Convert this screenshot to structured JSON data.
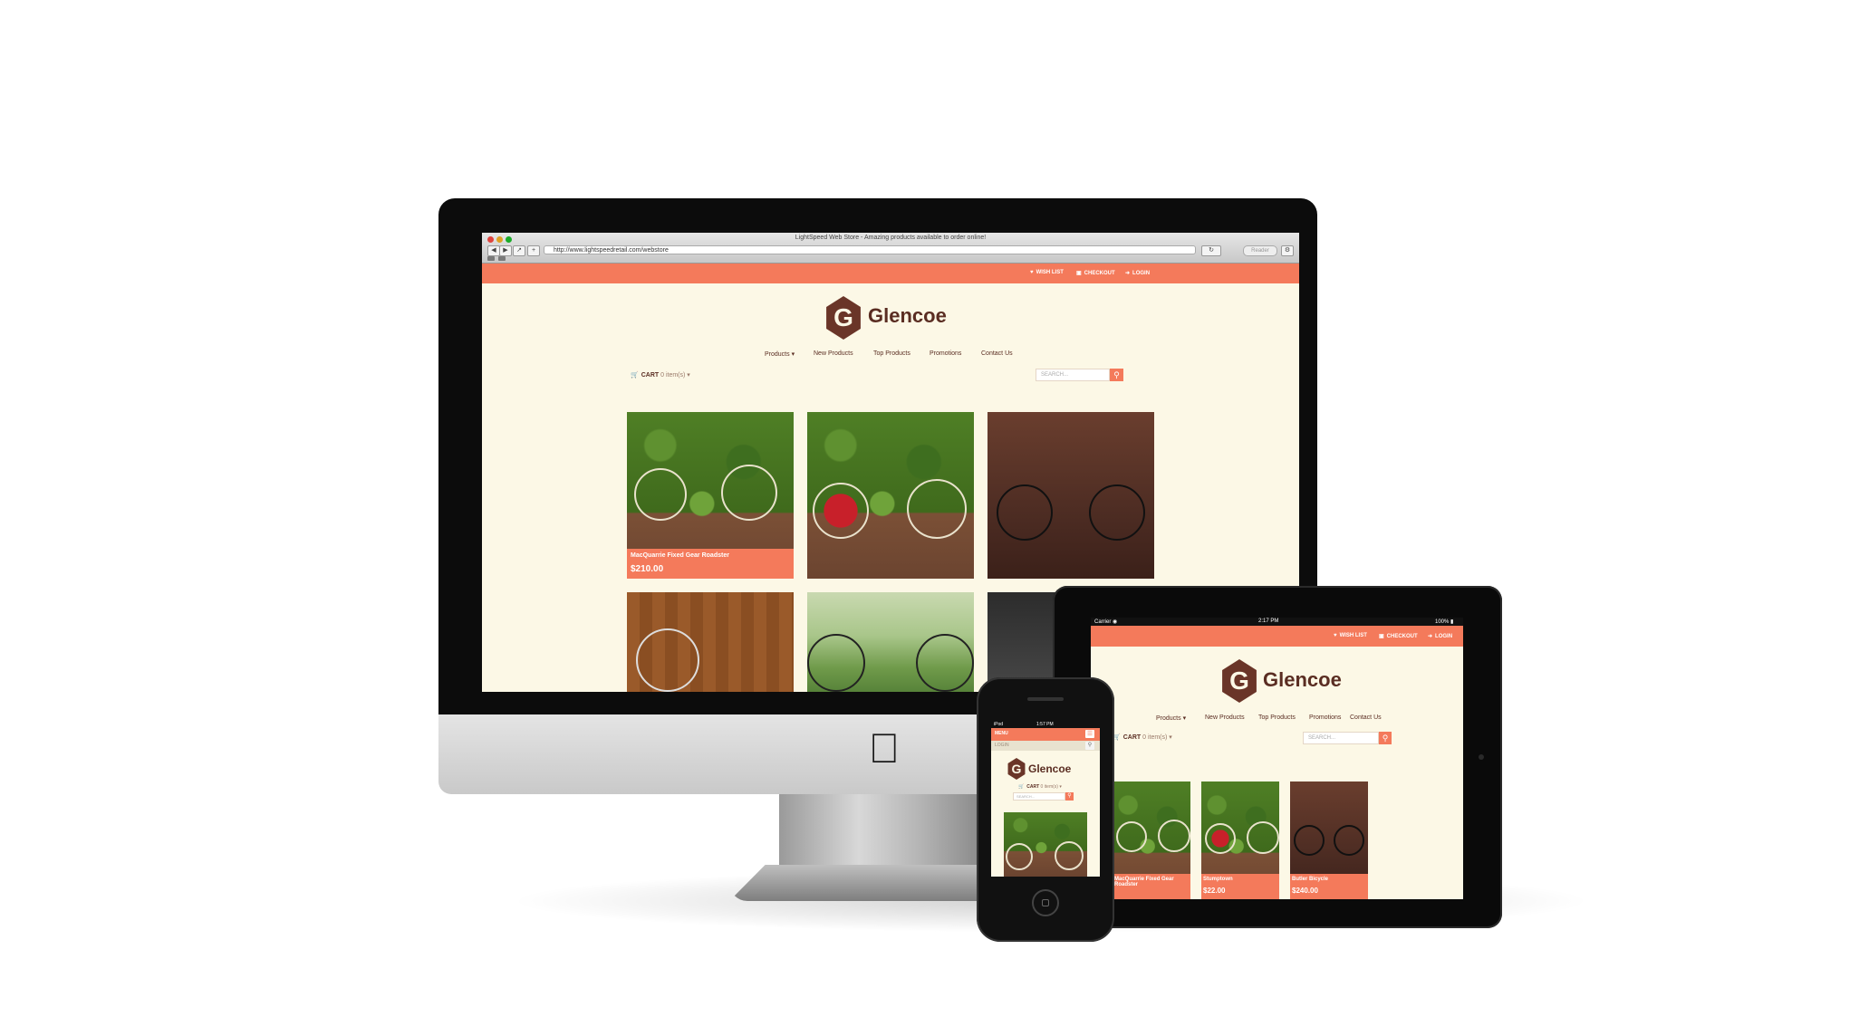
{
  "desktop": {
    "window_title": "LightSpeed Web Store - Amazing products available to order online!",
    "url": "http://www.lightspeedretail.com/webstore",
    "reader_label": "Reader",
    "top_links": [
      "WISH LIST",
      "CHECKOUT",
      "LOGIN"
    ],
    "logo_letter": "G",
    "logo_name": "Glencoe",
    "menu": [
      "Products ▾",
      "New Products",
      "Top Products",
      "Promotions",
      "Contact Us"
    ],
    "cart_label": "CART",
    "cart_count": "0 item(s) ▾",
    "search_placeholder": "SEARCH...",
    "products": [
      {
        "name": "MacQuarrie Fixed Gear Roadster",
        "price": "$210.00"
      }
    ]
  },
  "tablet": {
    "status_carrier": "Carrier ◉",
    "status_time": "2:17 PM",
    "status_battery": "100% ▮",
    "top_links": [
      "WISH LIST",
      "CHECKOUT",
      "LOGIN"
    ],
    "logo_letter": "G",
    "logo_name": "Glencoe",
    "menu": [
      "Products ▾",
      "New Products",
      "Top Products",
      "Promotions",
      "Contact Us"
    ],
    "cart_label": "CART",
    "cart_count": "0 item(s) ▾",
    "search_placeholder": "SEARCH...",
    "products": [
      {
        "name": "MacQuarrie Fixed Gear Roadster",
        "price": ""
      },
      {
        "name": "Stumptown",
        "price": "$22.00"
      },
      {
        "name": "Butler Bicycle",
        "price": "$240.00"
      }
    ]
  },
  "phone": {
    "status_carrier": "iPod",
    "status_time": "1:57 PM",
    "menu_label": "Menu",
    "login_label": "LOGIN",
    "logo_letter": "G",
    "logo_name": "Glencoe",
    "cart_label": "CART",
    "cart_count": "0 item(s) ▾",
    "search_placeholder": "SEARCH..."
  },
  "colors": {
    "accent": "#f47a5b",
    "background": "#fcf8e6",
    "brand_brown": "#6a3528"
  },
  "icons": [
    "cart-icon",
    "search-icon",
    "heart-icon",
    "checkout-icon",
    "login-icon",
    "apple-logo-icon"
  ]
}
